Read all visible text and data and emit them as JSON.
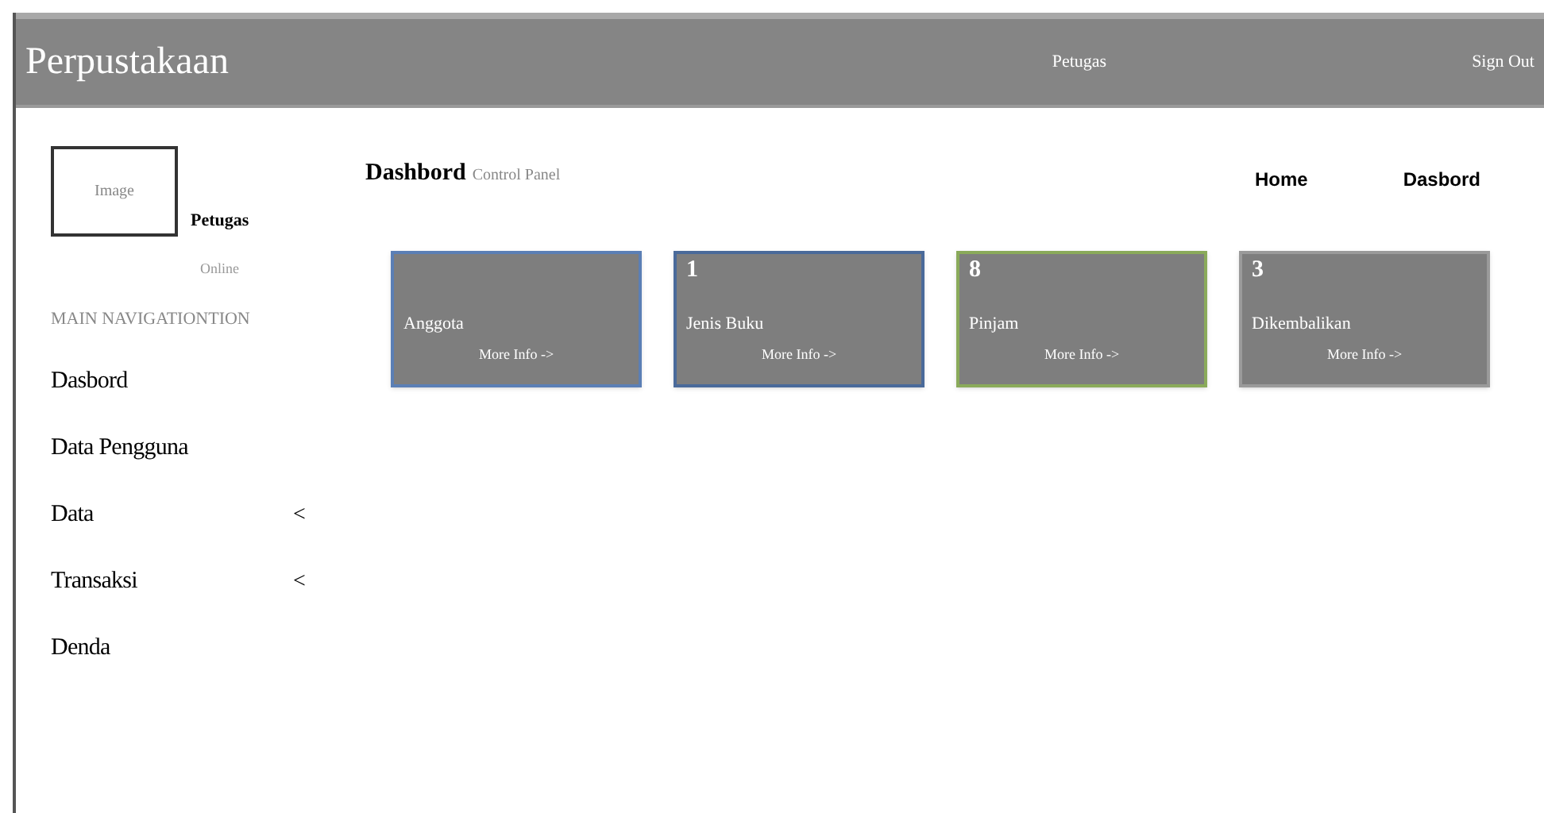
{
  "header": {
    "title": "Perpustakaan",
    "user": "Petugas",
    "sign_out": "Sign Out"
  },
  "sidebar": {
    "image_label": "Image",
    "user_name": "Petugas",
    "status": "Online",
    "section": "MAIN NAVIGATIONTION",
    "items": [
      {
        "label": "Dasbord"
      },
      {
        "label": "Data Pengguna"
      },
      {
        "label": "Data",
        "arrow": "<"
      },
      {
        "label": "Transaksi",
        "arrow": "<"
      },
      {
        "label": "Denda"
      }
    ]
  },
  "page": {
    "title": "Dashbord",
    "subtitle": "Control Panel",
    "breadcrumbs": [
      "Home",
      "Dasbord"
    ]
  },
  "cards": [
    {
      "label": "Anggota",
      "link": "More Info ->",
      "color": "#5b7fb5"
    },
    {
      "count": "1",
      "label": "Jenis Buku",
      "link": "More Info ->",
      "color": "#4a6a9a"
    },
    {
      "count": "8",
      "label": "Pinjam",
      "link": "More Info ->",
      "color": "#8aaa5a"
    },
    {
      "count": "3",
      "label": "Dikembalikan",
      "link": "More Info ->",
      "color": "#9a9a9a"
    }
  ]
}
